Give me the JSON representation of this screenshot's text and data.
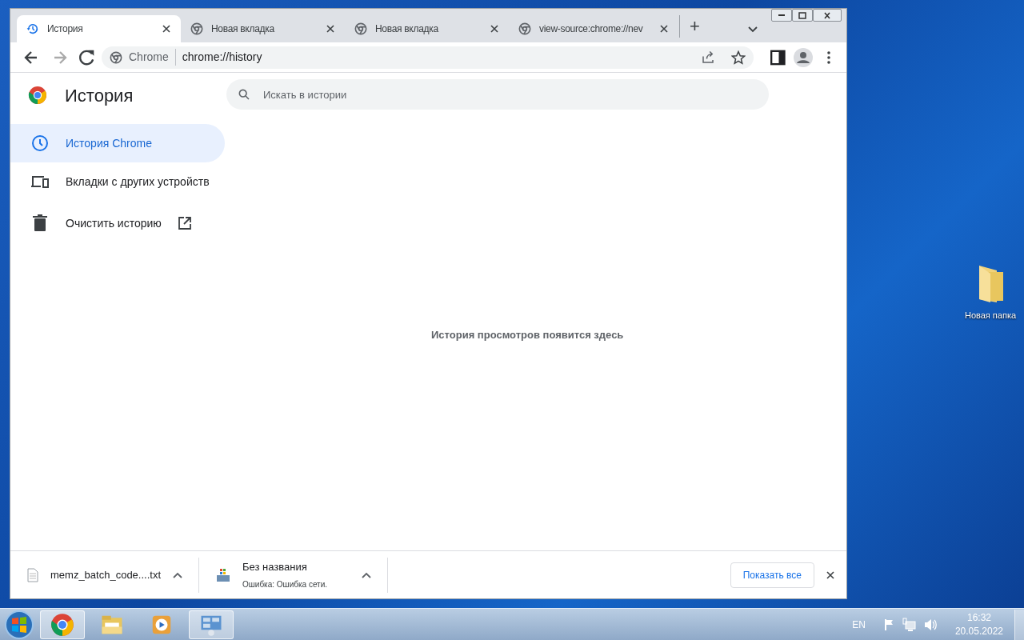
{
  "browser": {
    "tabs": [
      {
        "title": "История",
        "selected": true
      },
      {
        "title": "Новая вкладка",
        "selected": false
      },
      {
        "title": "Новая вкладка",
        "selected": false
      },
      {
        "title": "view-source:chrome://nev",
        "selected": false
      }
    ],
    "new_tab": "+",
    "address": {
      "chip": "Chrome",
      "url": "chrome://history"
    }
  },
  "page": {
    "title": "История",
    "search": {
      "placeholder": "Искать в истории"
    },
    "nav": [
      {
        "label": "История Chrome",
        "selected": true,
        "external": false
      },
      {
        "label": "Вкладки с других устройств",
        "selected": false,
        "external": false
      },
      {
        "label": "Очистить историю",
        "selected": false,
        "external": true
      }
    ],
    "empty_message": "История просмотров появится здесь"
  },
  "downloads": {
    "items": [
      {
        "name": "memz_batch_code....txt",
        "kind": "text"
      },
      {
        "name": "Без названия",
        "status": "Ошибка: Ошибка сети.",
        "kind": "installer"
      }
    ],
    "show_all": "Показать все"
  },
  "desktop": {
    "icons": [
      {
        "label": "Новая папка"
      }
    ]
  },
  "taskbar": {
    "apps": [
      {
        "kind": "chrome",
        "selected": true
      },
      {
        "kind": "explorer",
        "selected": false
      },
      {
        "kind": "media",
        "selected": false
      },
      {
        "kind": "control",
        "selected": true
      }
    ],
    "tray": {
      "language": "EN",
      "time": "16:32",
      "date": "20.05.2022"
    }
  }
}
